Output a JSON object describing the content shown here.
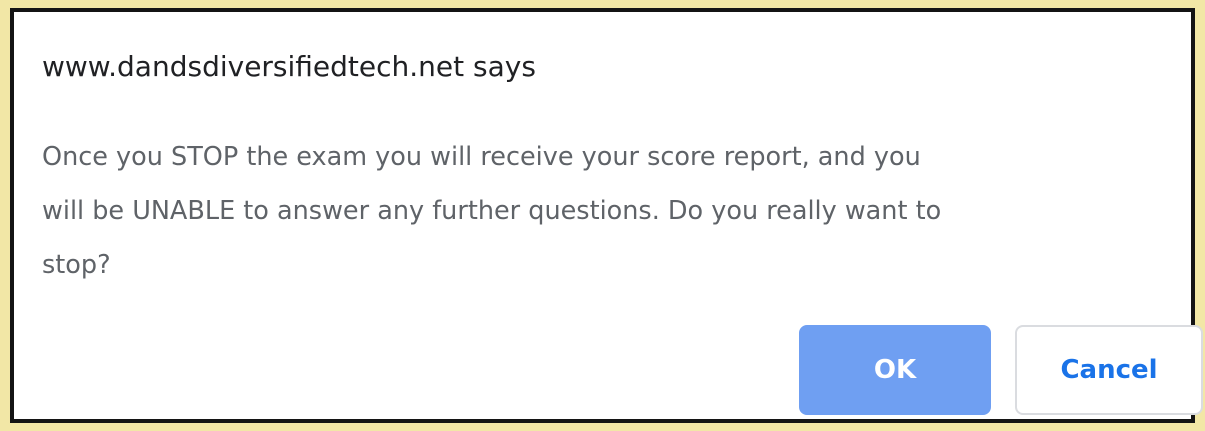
{
  "dialog": {
    "origin": "www.dandsdiversifiedtech.net says",
    "message_lines": [
      "Once you STOP the exam you will receive your score report, and you",
      "will be UNABLE to answer any further questions. Do you really want to",
      "stop?"
    ],
    "ok_label": "OK",
    "cancel_label": "Cancel"
  },
  "colors": {
    "ok_button": "#6f9ff2",
    "cancel_text": "#1a73e8",
    "page_background": "#f2e7a6",
    "dialog_border": "#141414"
  }
}
